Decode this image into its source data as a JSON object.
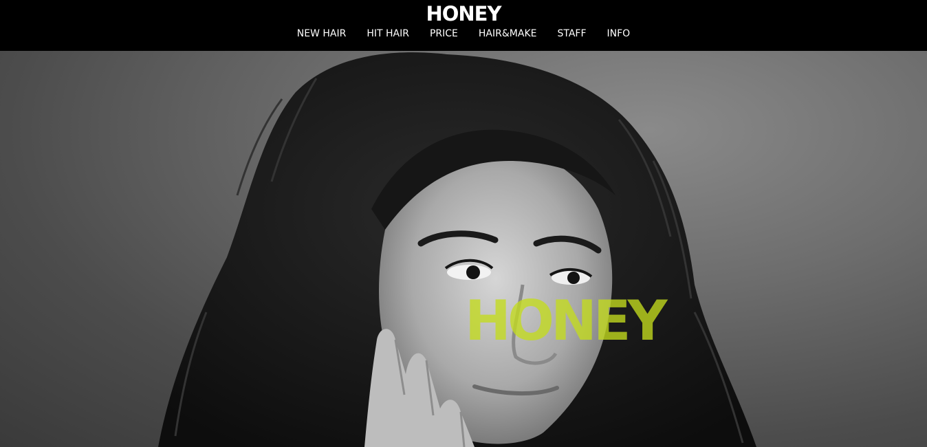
{
  "header": {
    "logo": "HONEY",
    "nav": [
      {
        "label": "NEW HAIR"
      },
      {
        "label": "HIT HAIR"
      },
      {
        "label": "PRICE"
      },
      {
        "label": "HAIR&MAKE"
      },
      {
        "label": "STAFF"
      },
      {
        "label": "INFO"
      }
    ]
  },
  "hero": {
    "title": "HONEY",
    "title_color": "#c4dc1e",
    "image_subject": "black-and-white portrait photo of a woman with curly hair resting cheek on hand"
  },
  "colors": {
    "header_bg": "#000000",
    "nav_text": "#ffffff"
  }
}
